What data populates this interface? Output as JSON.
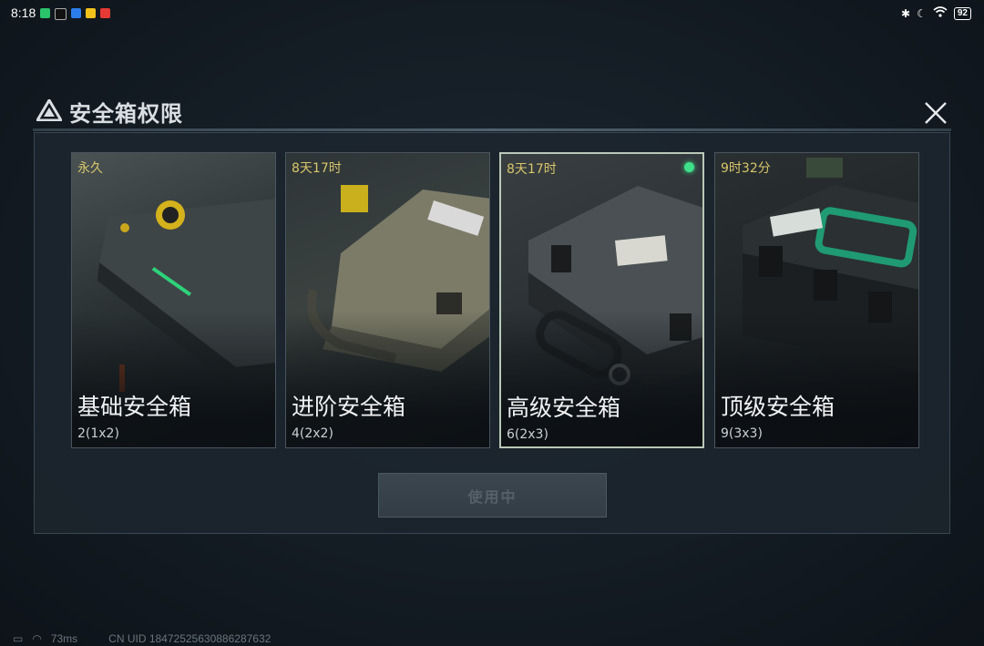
{
  "status_bar": {
    "time": "8:18",
    "battery": "92",
    "app_icons": [
      "wechat-icon",
      "tiktok-icon",
      "app-blue-icon",
      "app-yellow-icon",
      "app-red-icon"
    ],
    "right_icons": [
      "bluetooth-icon",
      "moon-icon",
      "wifi-icon"
    ]
  },
  "dialog": {
    "title": "安全箱权限",
    "close_icon": "close-icon"
  },
  "cards": [
    {
      "duration": "永久",
      "name": "基础安全箱",
      "capacity": "2(1x2)",
      "selected": false,
      "accent": "#2f3a3a"
    },
    {
      "duration": "8天17时",
      "name": "进阶安全箱",
      "capacity": "4(2x2)",
      "selected": false,
      "accent": "#5a5c4c"
    },
    {
      "duration": "8天17时",
      "name": "高级安全箱",
      "capacity": "6(2x3)",
      "selected": true,
      "accent": "#3c4244"
    },
    {
      "duration": "9时32分",
      "name": "顶级安全箱",
      "capacity": "9(3x3)",
      "selected": false,
      "accent": "#1f9a72"
    }
  ],
  "use_button": {
    "label": "使用中"
  },
  "footer": {
    "ping": "73ms",
    "uid": "CN UID 18472525630886287632"
  },
  "colors": {
    "duration_text": "#d8c66a",
    "active_dot": "#3ee08a",
    "selected_border": "#b9c8b8"
  }
}
